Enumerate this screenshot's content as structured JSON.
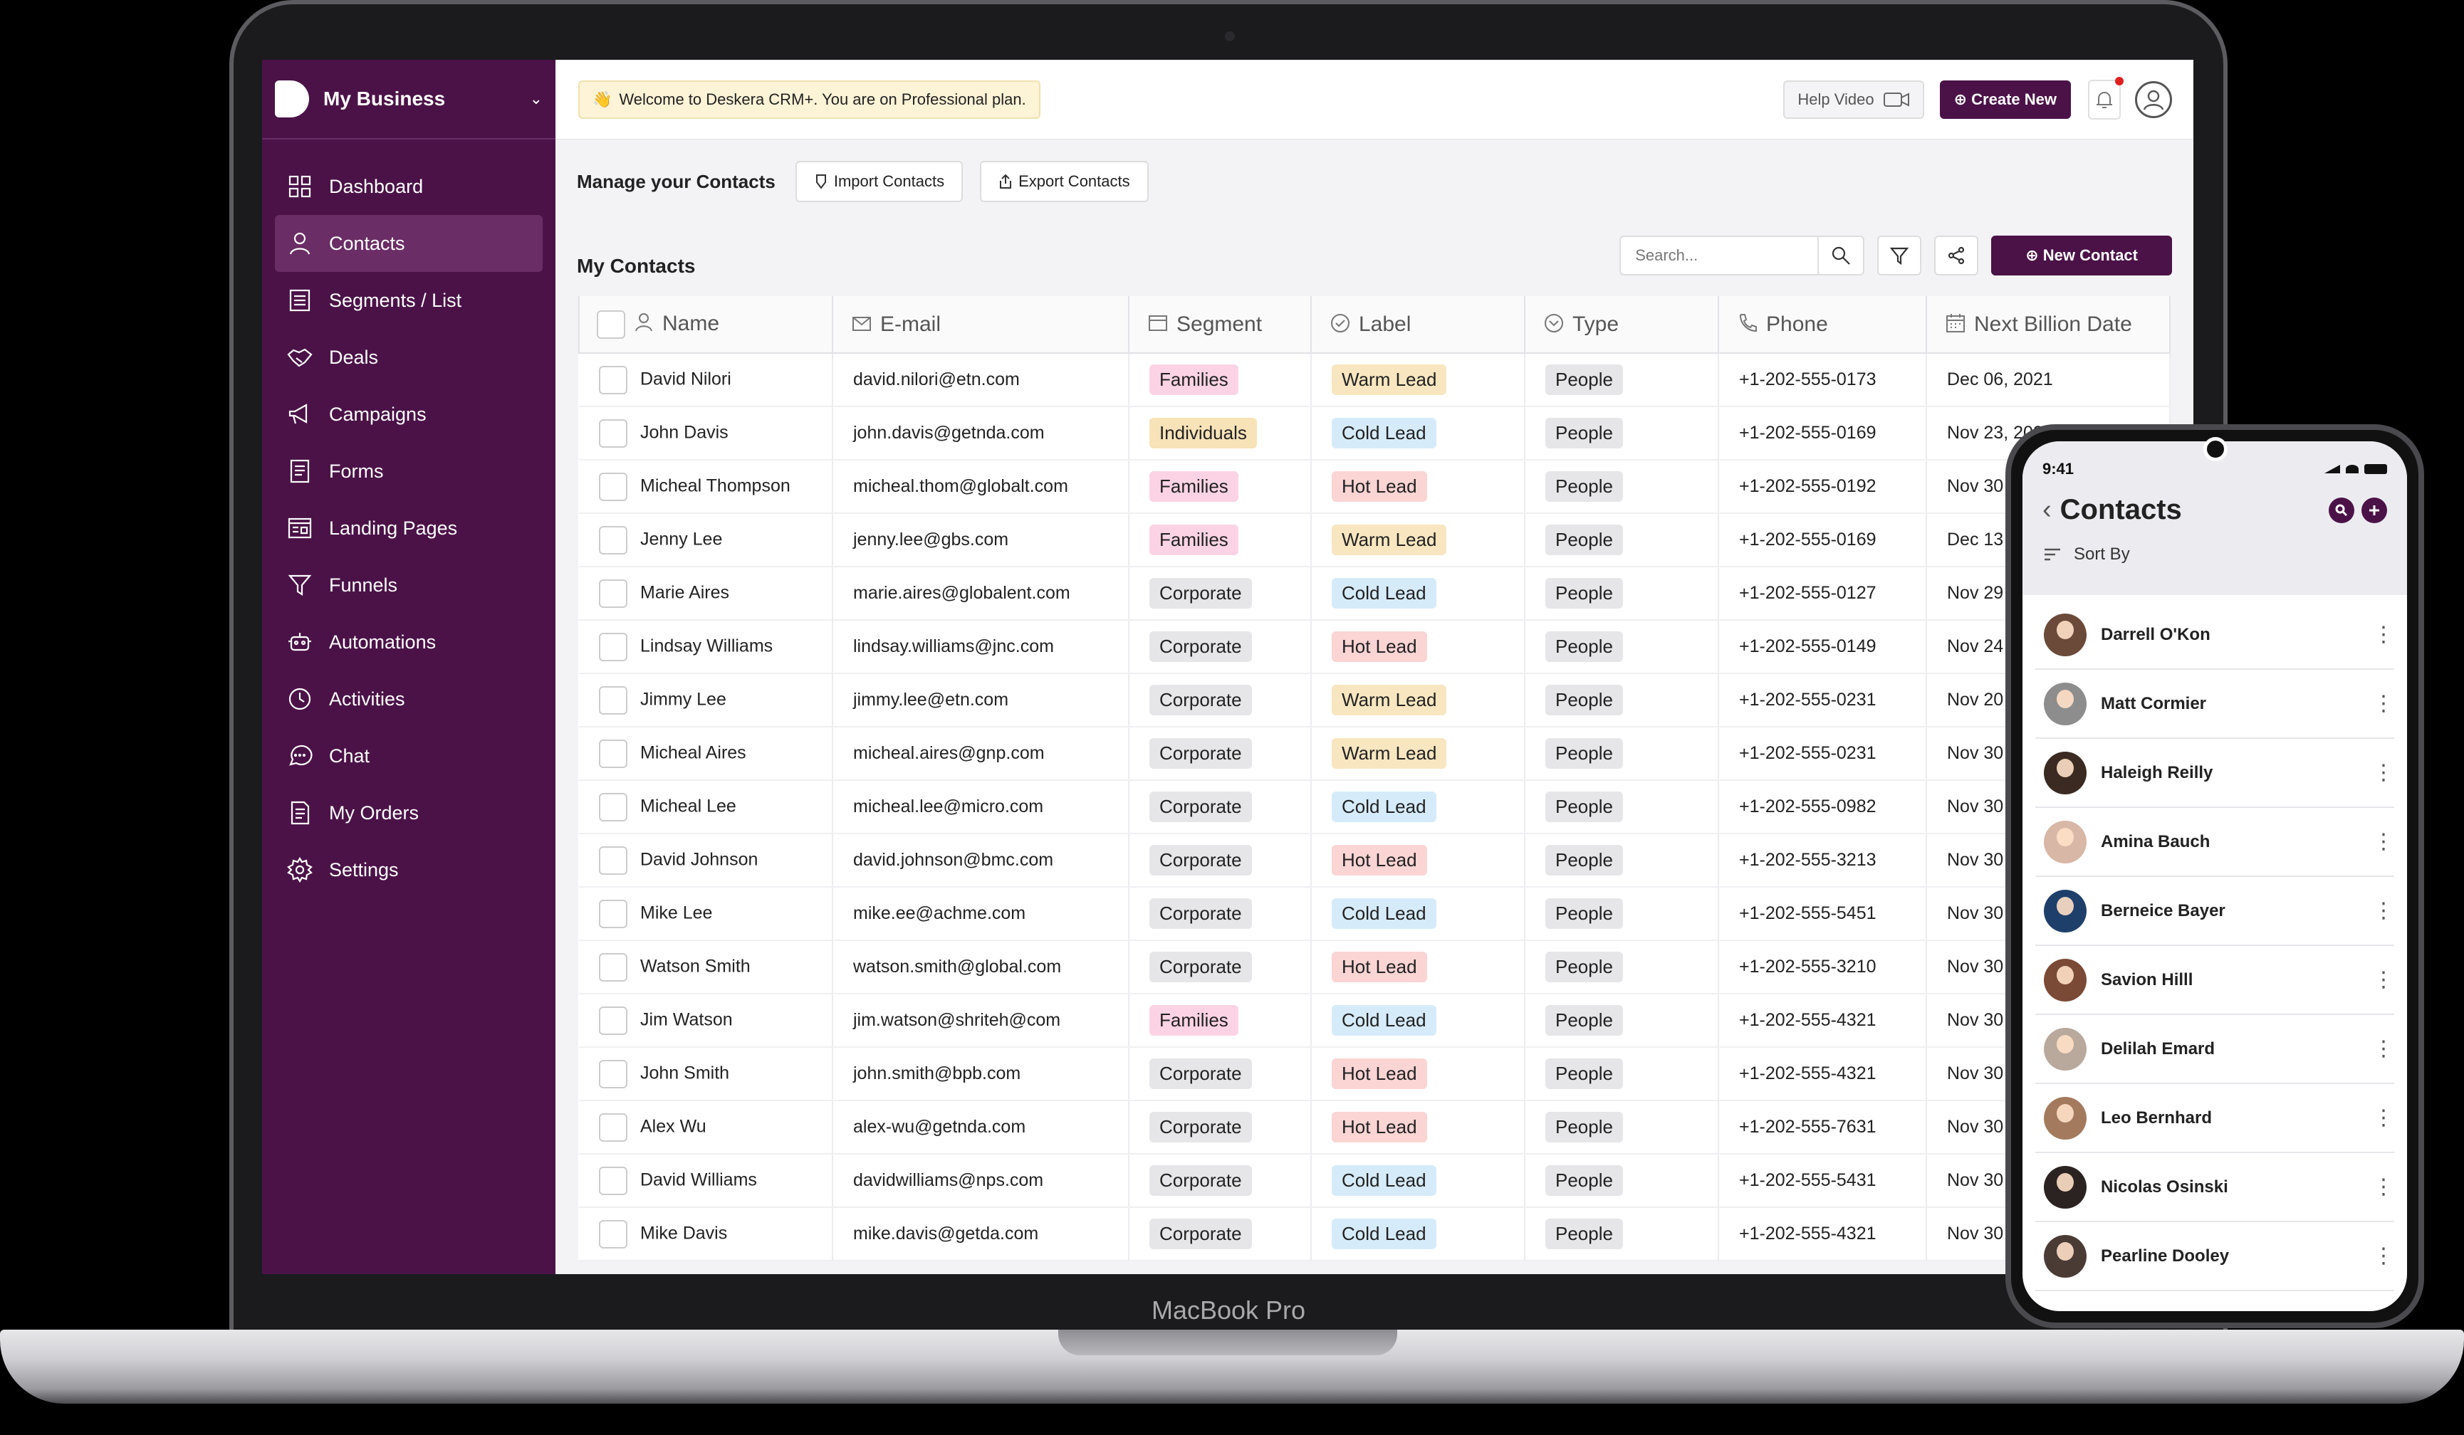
{
  "device": {
    "bezel_label": "MacBook Pro"
  },
  "sidebar": {
    "brand": "My Business",
    "items": [
      {
        "label": "Dashboard",
        "icon": "dashboard-icon"
      },
      {
        "label": "Contacts",
        "icon": "user-icon",
        "active": true
      },
      {
        "label": "Segments / List",
        "icon": "list-icon"
      },
      {
        "label": "Deals",
        "icon": "handshake-icon"
      },
      {
        "label": "Campaigns",
        "icon": "megaphone-icon"
      },
      {
        "label": "Forms",
        "icon": "form-icon"
      },
      {
        "label": "Landing Pages",
        "icon": "landing-page-icon"
      },
      {
        "label": "Funnels",
        "icon": "funnel-icon"
      },
      {
        "label": "Automations",
        "icon": "robot-icon"
      },
      {
        "label": "Activities",
        "icon": "clock-icon"
      },
      {
        "label": "Chat",
        "icon": "chat-icon"
      },
      {
        "label": "My Orders",
        "icon": "orders-icon"
      },
      {
        "label": "Settings",
        "icon": "gear-icon"
      }
    ]
  },
  "topbar": {
    "welcome": "Welcome to Deskera CRM+. You are on Professional plan.",
    "help_video": "Help Video",
    "create_new": "Create New"
  },
  "manage": {
    "title": "Manage your Contacts",
    "import": "Import Contacts",
    "export": "Export Contacts"
  },
  "contacts": {
    "title": "My Contacts",
    "search_placeholder": "Search...",
    "new_contact": "New Contact",
    "columns": [
      "Name",
      "E-mail",
      "Segment",
      "Label",
      "Type",
      "Phone",
      "Next Billion Date"
    ],
    "rows": [
      {
        "name": "David Nilori",
        "email": "david.nilori@etn.com",
        "segment": "Families",
        "label": "Warm Lead",
        "type": "People",
        "phone": "+1-202-555-0173",
        "date": "Dec 06, 2021"
      },
      {
        "name": "John Davis",
        "email": "john.davis@getnda.com",
        "segment": "Individuals",
        "label": "Cold Lead",
        "type": "People",
        "phone": "+1-202-555-0169",
        "date": "Nov 23, 2021"
      },
      {
        "name": "Micheal Thompson",
        "email": "micheal.thom@globalt.com",
        "segment": "Families",
        "label": "Hot Lead",
        "type": "People",
        "phone": "+1-202-555-0192",
        "date": "Nov 30"
      },
      {
        "name": "Jenny Lee",
        "email": "jenny.lee@gbs.com",
        "segment": "Families",
        "label": "Warm Lead",
        "type": "People",
        "phone": "+1-202-555-0169",
        "date": "Dec 13"
      },
      {
        "name": "Marie Aires",
        "email": "marie.aires@globalent.com",
        "segment": "Corporate",
        "label": "Cold Lead",
        "type": "People",
        "phone": "+1-202-555-0127",
        "date": "Nov 29"
      },
      {
        "name": "Lindsay Williams",
        "email": "lindsay.williams@jnc.com",
        "segment": "Corporate",
        "label": "Hot Lead",
        "type": "People",
        "phone": "+1-202-555-0149",
        "date": "Nov 24"
      },
      {
        "name": "Jimmy Lee",
        "email": "jimmy.lee@etn.com",
        "segment": "Corporate",
        "label": "Warm Lead",
        "type": "People",
        "phone": "+1-202-555-0231",
        "date": "Nov 20"
      },
      {
        "name": "Micheal Aires",
        "email": "micheal.aires@gnp.com",
        "segment": "Corporate",
        "label": "Warm Lead",
        "type": "People",
        "phone": "+1-202-555-0231",
        "date": "Nov 30"
      },
      {
        "name": "Micheal Lee",
        "email": "micheal.lee@micro.com",
        "segment": "Corporate",
        "label": "Cold Lead",
        "type": "People",
        "phone": "+1-202-555-0982",
        "date": "Nov 30"
      },
      {
        "name": "David Johnson",
        "email": "david.johnson@bmc.com",
        "segment": "Corporate",
        "label": "Hot Lead",
        "type": "People",
        "phone": "+1-202-555-3213",
        "date": "Nov 30"
      },
      {
        "name": "Mike Lee",
        "email": "mike.ee@achme.com",
        "segment": "Corporate",
        "label": "Cold Lead",
        "type": "People",
        "phone": "+1-202-555-5451",
        "date": "Nov 30"
      },
      {
        "name": "Watson Smith",
        "email": "watson.smith@global.com",
        "segment": "Corporate",
        "label": "Hot Lead",
        "type": "People",
        "phone": "+1-202-555-3210",
        "date": "Nov 30"
      },
      {
        "name": "Jim Watson",
        "email": "jim.watson@shriteh@com",
        "segment": "Families",
        "label": "Cold Lead",
        "type": "People",
        "phone": "+1-202-555-4321",
        "date": "Nov 30"
      },
      {
        "name": "John Smith",
        "email": "john.smith@bpb.com",
        "segment": "Corporate",
        "label": "Hot Lead",
        "type": "People",
        "phone": "+1-202-555-4321",
        "date": "Nov 30"
      },
      {
        "name": "Alex Wu",
        "email": "alex-wu@getnda.com",
        "segment": "Corporate",
        "label": "Hot Lead",
        "type": "People",
        "phone": "+1-202-555-7631",
        "date": "Nov 30"
      },
      {
        "name": "David Williams",
        "email": "davidwilliams@nps.com",
        "segment": "Corporate",
        "label": "Cold Lead",
        "type": "People",
        "phone": "+1-202-555-5431",
        "date": "Nov 30"
      },
      {
        "name": "Mike Davis",
        "email": "mike.davis@getda.com",
        "segment": "Corporate",
        "label": "Cold Lead",
        "type": "People",
        "phone": "+1-202-555-4321",
        "date": "Nov 30"
      }
    ]
  },
  "phone": {
    "time": "9:41",
    "title": "Contacts",
    "sort_by": "Sort By",
    "contacts": [
      {
        "name": "Darrell O'Kon",
        "avatar_color": "#6b4a3a"
      },
      {
        "name": "Matt Cormier",
        "avatar_color": "#8d8d8d"
      },
      {
        "name": "Haleigh Reilly",
        "avatar_color": "#3a2a22"
      },
      {
        "name": "Amina Bauch",
        "avatar_color": "#d8b7a6"
      },
      {
        "name": "Berneice Bayer",
        "avatar_color": "#1f3f6b"
      },
      {
        "name": "Savion Hilll",
        "avatar_color": "#7a4a36"
      },
      {
        "name": "Delilah Emard",
        "avatar_color": "#b9a89c"
      },
      {
        "name": "Leo Bernhard",
        "avatar_color": "#a47a5e"
      },
      {
        "name": "Nicolas Osinski",
        "avatar_color": "#2b2321"
      },
      {
        "name": "Pearline Dooley",
        "avatar_color": "#4a3b35"
      }
    ]
  },
  "colors": {
    "brand": "#4b1248",
    "brand_active": "#6b2d66"
  }
}
